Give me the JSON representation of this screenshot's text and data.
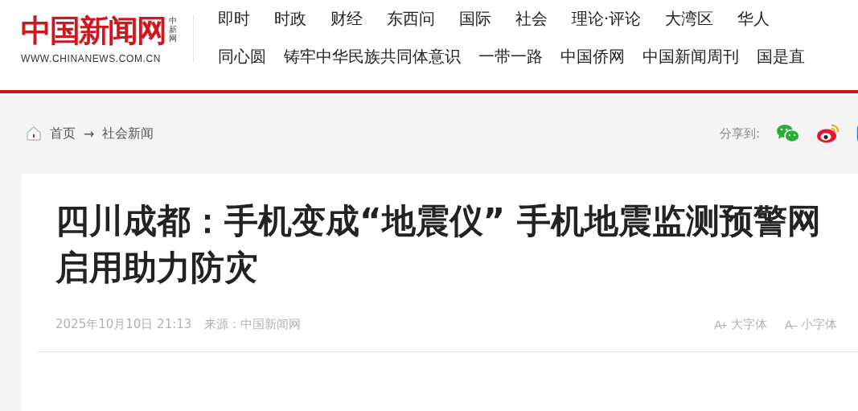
{
  "logo": {
    "name": "中国新闻网",
    "side": "中新网",
    "url": "WWW.CHINANEWS.COM.CN"
  },
  "nav": [
    [
      "即时",
      "时政",
      "财经",
      "东西问",
      "国际",
      "社会",
      "理论·评论",
      "大湾区",
      "华人"
    ],
    [
      "同心圆",
      "铸牢中华民族共同体意识",
      "一带一路",
      "中国侨网",
      "中国新闻周刊",
      "国是直"
    ]
  ],
  "breadcrumb": {
    "home": "首页",
    "arrow": "→",
    "section": "社会新闻"
  },
  "share": {
    "label": "分享到:"
  },
  "article": {
    "title": "四川成都：手机变成“地震仪” 手机地震监测预警网启用助力防灾",
    "date": "2025年10月10日 21:13",
    "source": "来源：中国新闻网",
    "font_buttons": [
      {
        "glyph": "A+",
        "label": "大字体"
      },
      {
        "glyph": "A–",
        "label": "小字体"
      }
    ]
  }
}
